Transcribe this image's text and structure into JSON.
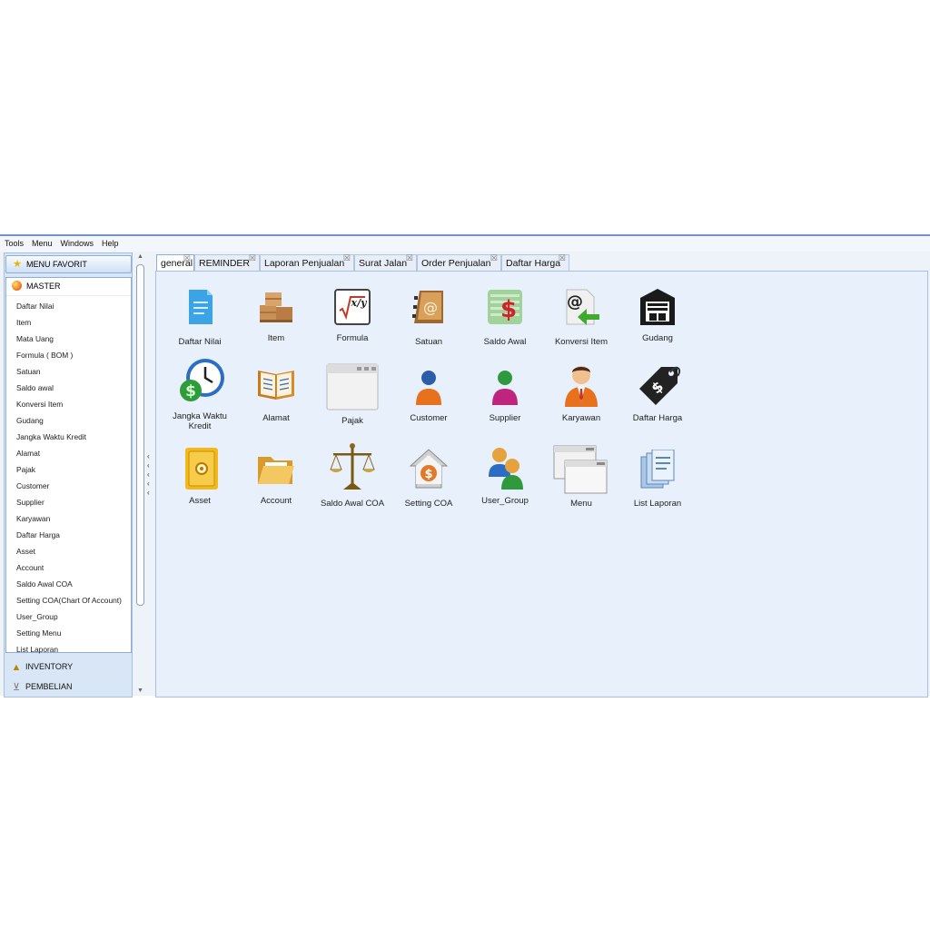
{
  "menubar": {
    "items": [
      "Tools",
      "Menu",
      "Windows",
      "Help"
    ]
  },
  "sidebar": {
    "favorite": "MENU FAVORIT",
    "master": {
      "title": "MASTER",
      "items": [
        "Daftar Nilai",
        "Item",
        "Mata Uang",
        "Formula ( BOM )",
        "Satuan",
        "Saldo awal",
        "Konversi Item",
        "Gudang",
        "Jangka Waktu Kredit",
        "Alamat",
        "Pajak",
        "Customer",
        "Supplier",
        "Karyawan",
        "Daftar Harga",
        "Asset",
        "Account",
        "Saldo Awal COA",
        "Setting COA(Chart Of Account)",
        "User_Group",
        "Setting Menu",
        "List Laporan"
      ]
    },
    "sections": [
      "INVENTORY",
      "PEMBELIAN"
    ]
  },
  "tabs": [
    "general",
    "REMINDER",
    "Laporan Penjualan",
    "Surat Jalan",
    "Order Penjualan",
    "Daftar Harga"
  ],
  "tiles": {
    "daftar_nilai": "Daftar Nilai",
    "item": "Item",
    "formula": "Formula",
    "satuan": "Satuan",
    "saldo_awal": "Saldo Awal",
    "konversi_item": "Konversi Item",
    "gudang": "Gudang",
    "jangka_waktu_kredit": "Jangka Waktu Kredit",
    "alamat": "Alamat",
    "pajak": "Pajak",
    "customer": "Customer",
    "supplier": "Supplier",
    "karyawan": "Karyawan",
    "daftar_harga": "Daftar Harga",
    "asset": "Asset",
    "account": "Account",
    "saldo_awal_coa": "Saldo Awal COA",
    "setting_coa": "Setting COA",
    "user_group": "User_Group",
    "menu": "Menu",
    "list_laporan": "List Laporan"
  },
  "icon_glyphs": {
    "formula": "x/y",
    "satuan": "@",
    "saldo_awal": "$",
    "konversi_item": "@",
    "daftar_harga": "$"
  }
}
